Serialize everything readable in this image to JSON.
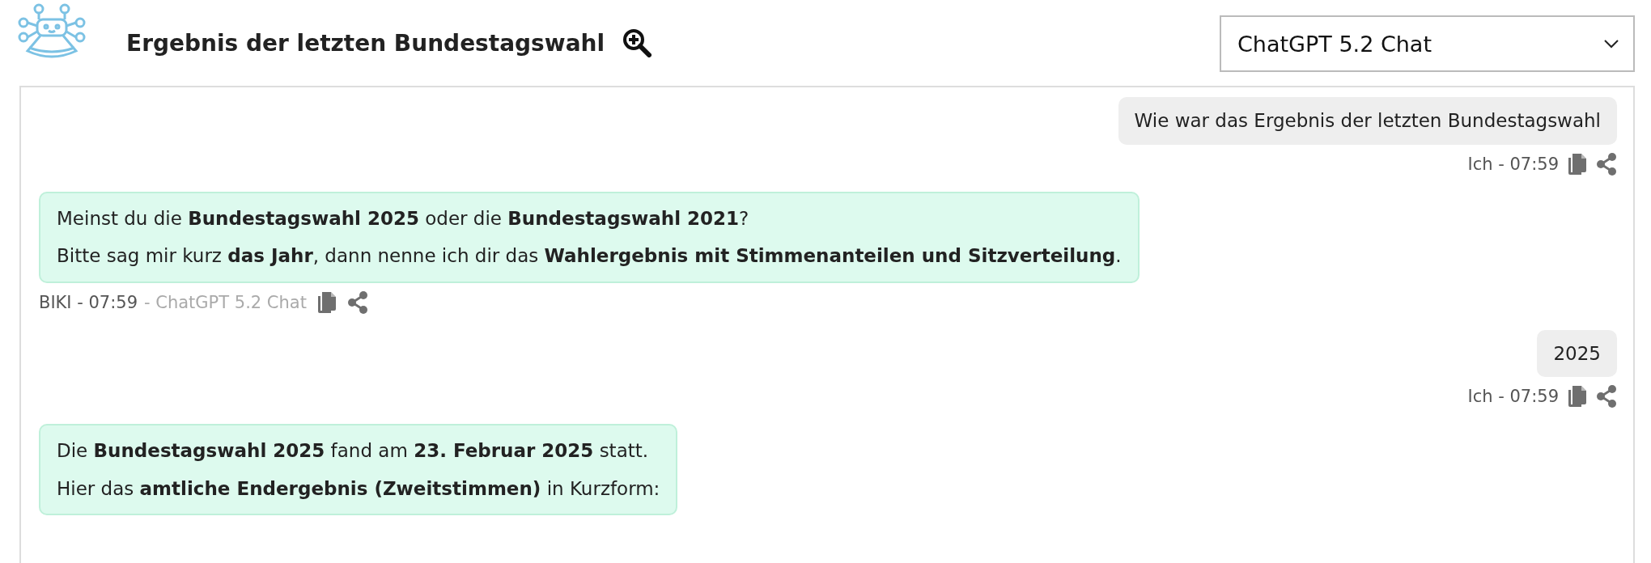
{
  "header": {
    "title": "Ergebnis der letzten Bundestagswahl",
    "model_select": {
      "value": "ChatGPT 5.2 Chat"
    }
  },
  "messages": [
    {
      "kind": "user",
      "paragraphs": [
        "Wie war das Ergebnis der letzten Bundestagswahl"
      ],
      "meta": {
        "author_time": "Ich - 07:59"
      }
    },
    {
      "kind": "bot",
      "paragraphs": [
        "Meinst du die **Bundestagswahl 2025** oder die **Bundestagswahl 2021**?",
        "Bitte sag mir kurz **das Jahr**, dann nenne ich dir das **Wahlergebnis mit Stimmenanteilen und Sitzverteilung**."
      ],
      "meta": {
        "author_time": "BIKI - 07:59",
        "model": "- ChatGPT 5.2 Chat"
      }
    },
    {
      "kind": "user",
      "paragraphs": [
        "2025"
      ],
      "meta": {
        "author_time": "Ich - 07:59"
      }
    },
    {
      "kind": "bot",
      "paragraphs": [
        "Die **Bundestagswahl 2025** fand am **23. Februar 2025** statt.",
        "Hier das **amtliche Endergebnis (Zweitstimmen)** in Kurzform:"
      ]
    }
  ]
}
